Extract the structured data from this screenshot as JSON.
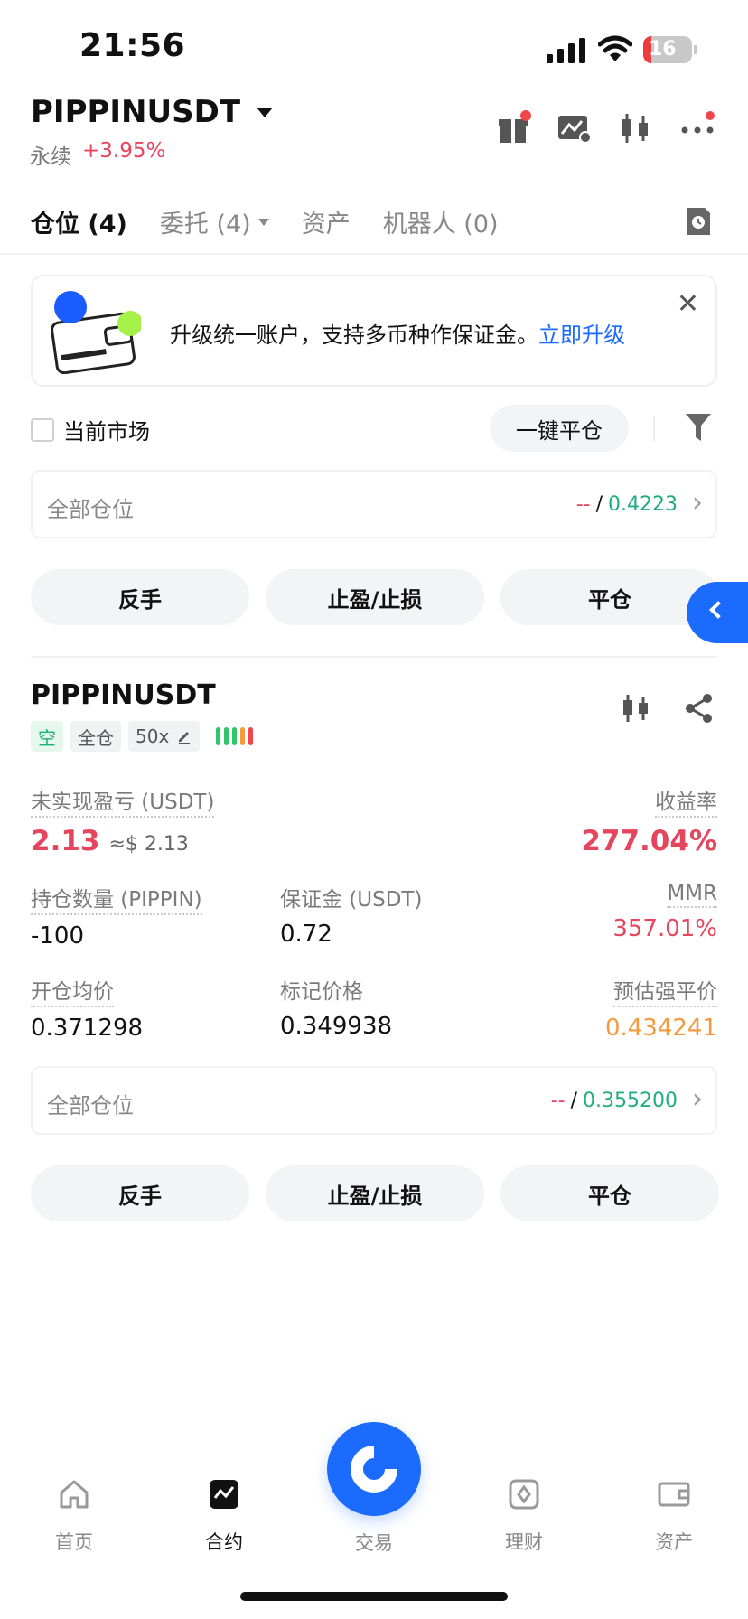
{
  "status": {
    "time": "21:56",
    "battery": "16",
    "battery_level": 0.16
  },
  "header": {
    "symbol": "PIPPINUSDT",
    "contract_type": "永续",
    "change": "+3.95%"
  },
  "tabs": [
    {
      "label": "仓位 (4)"
    },
    {
      "label": "委托 (4)"
    },
    {
      "label": "资产"
    },
    {
      "label": "机器人 (0)"
    }
  ],
  "banner": {
    "text": "升级统一账户，支持多币种作保证金。",
    "link": "立即升级",
    "close": "✕"
  },
  "controls": {
    "current_market": "当前市场",
    "close_all": "一键平仓"
  },
  "summary1": {
    "label": "全部仓位",
    "dash": "--",
    "slash": "/",
    "value": "0.4223"
  },
  "actions": {
    "reverse": "反手",
    "tpsl": "止盈/止损",
    "close": "平仓"
  },
  "position": {
    "symbol": "PIPPINUSDT",
    "side": "空",
    "margin_mode": "全仓",
    "leverage": "50x",
    "unrealized_label": "未实现盈亏 (USDT)",
    "unrealized_value": "2.13",
    "unrealized_approx": "≈$ 2.13",
    "roe_label": "收益率",
    "roe_value": "277.04%",
    "qty_label": "持仓数量 (PIPPIN)",
    "qty_value": "-100",
    "margin_label": "保证金 (USDT)",
    "margin_value": "0.72",
    "mmr_label": "MMR",
    "mmr_value": "357.01%",
    "entry_label": "开仓均价",
    "entry_value": "0.371298",
    "mark_label": "标记价格",
    "mark_value": "0.349938",
    "liq_label": "预估强平价",
    "liq_value": "0.434241"
  },
  "summary2": {
    "label": "全部仓位",
    "dash": "--",
    "slash": "/",
    "value": "0.355200"
  },
  "nav": [
    {
      "label": "首页"
    },
    {
      "label": "合约"
    },
    {
      "label": "交易"
    },
    {
      "label": "理财"
    },
    {
      "label": "资产"
    }
  ],
  "colors": {
    "accent": "#1b6bff",
    "up": "#e5455d",
    "down": "#1fae7e",
    "warn": "#f59a3c"
  }
}
